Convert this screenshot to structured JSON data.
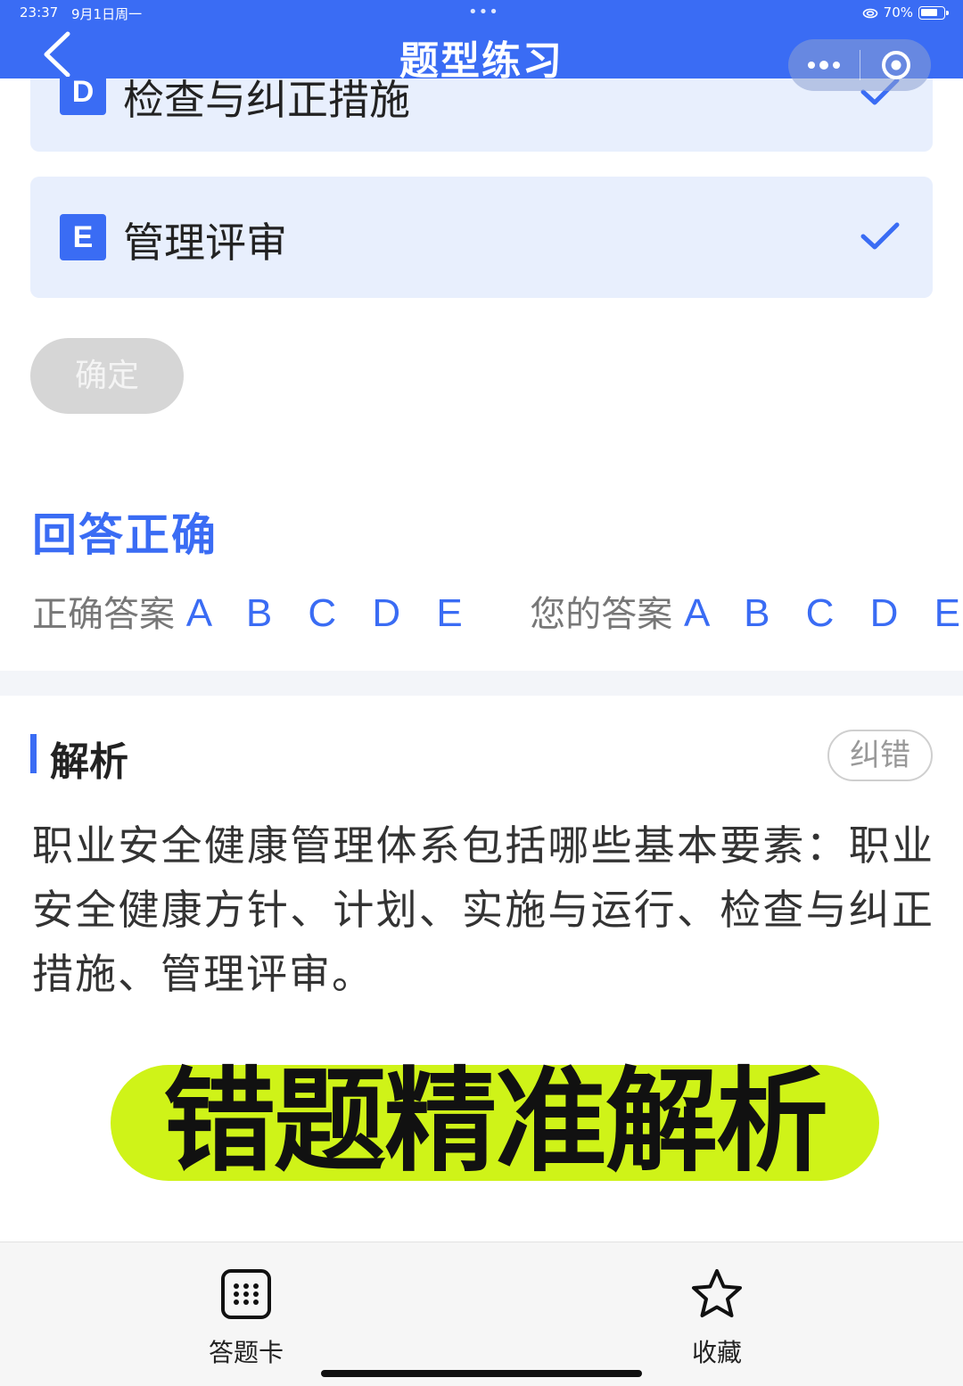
{
  "status": {
    "time": "23:37",
    "date": "9月1日周一",
    "dots": "•••",
    "battery": "70%"
  },
  "header": {
    "title": "题型练习"
  },
  "options": [
    {
      "letter": "D",
      "text": "检查与纠正措施",
      "selected": true
    },
    {
      "letter": "E",
      "text": "管理评审",
      "selected": true
    }
  ],
  "confirm_label": "确定",
  "result": {
    "title": "回答正确",
    "correct_label": "正确答案",
    "correct_value": "A B C D E",
    "yours_label": "您的答案",
    "yours_value": "A B C D E"
  },
  "analysis": {
    "title": "解析",
    "report_label": "纠错",
    "text": "职业安全健康管理体系包括哪些基本要素：职业安全健康方针、计划、实施与运行、检查与纠正措施、管理评审。"
  },
  "promo": {
    "text": "错题精准解析"
  },
  "bottom_bar": {
    "answer_card_label": "答题卡",
    "favorite_label": "收藏"
  },
  "colors": {
    "accent": "#3a6cf4",
    "option_bg": "#e8effd",
    "promo_bg": "#cff318"
  },
  "icons": [
    "chevron-left-icon",
    "more-dots-icon",
    "target-close-icon",
    "check-icon",
    "grid-icon",
    "star-icon",
    "wifi-icon",
    "battery-icon"
  ]
}
